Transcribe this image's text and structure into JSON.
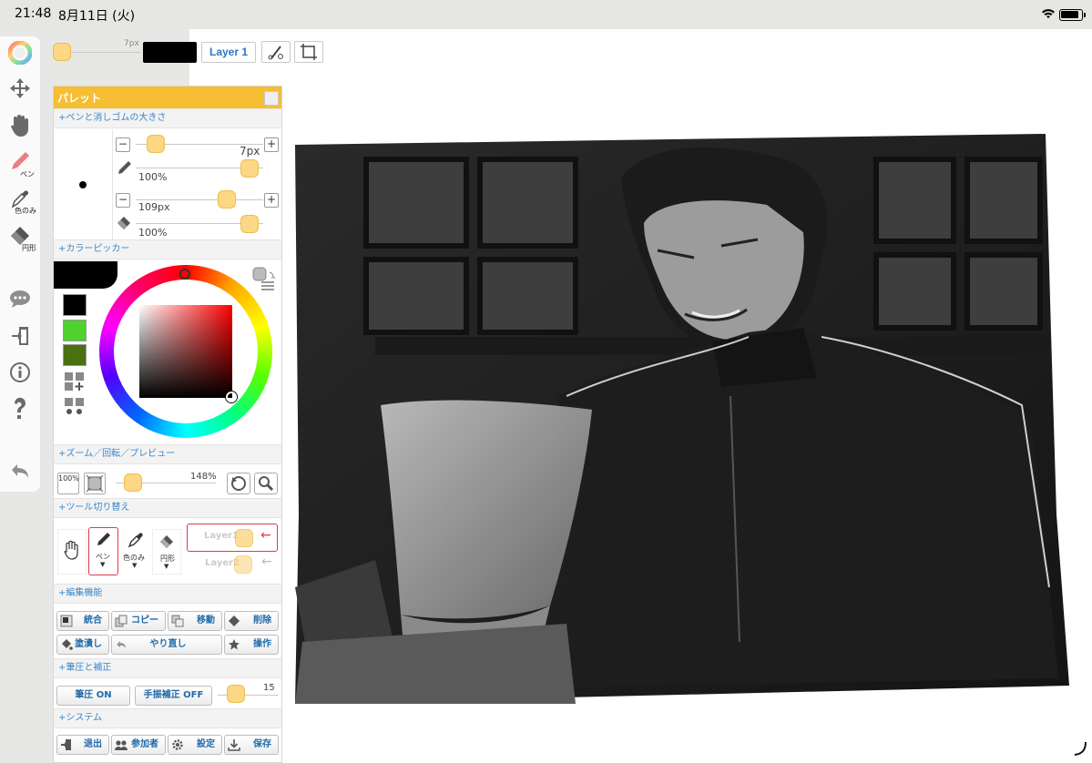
{
  "status": {
    "time": "21:48",
    "date": "8月11日 (火)"
  },
  "toolbar": {
    "items": [
      {
        "name": "color-wheel-icon",
        "label": ""
      },
      {
        "name": "move-icon",
        "label": ""
      },
      {
        "name": "hand-icon",
        "label": ""
      },
      {
        "name": "pen-icon",
        "label": "ペン"
      },
      {
        "name": "eyedropper-icon",
        "label": "色のみ"
      },
      {
        "name": "eraser-icon",
        "label": "円形"
      },
      {
        "name": "chat-icon",
        "label": ""
      },
      {
        "name": "exit-icon",
        "label": ""
      },
      {
        "name": "info-icon",
        "label": ""
      },
      {
        "name": "help-icon",
        "label": ""
      },
      {
        "name": "undo-icon",
        "label": ""
      }
    ]
  },
  "topbar": {
    "size_label": "7px",
    "layer_label": "Layer 1"
  },
  "palette": {
    "title": "パレット",
    "sections": {
      "brush": "+ペンと消しゴムの大きさ",
      "color": "+カラーピッカー",
      "zoom": "+ズーム／回転／プレビュー",
      "tools": "+ツール切り替え",
      "edit": "+編集機能",
      "pressure": "+筆圧と補正",
      "system": "+システム"
    },
    "pen": {
      "size": "7px",
      "opacity": "100%"
    },
    "eraser": {
      "size": "109px",
      "opacity": "100%"
    },
    "swatches": [
      "#000000",
      "#4fd12e",
      "#4a7010"
    ],
    "zoom": {
      "reset": "100%",
      "level": "148%"
    },
    "tool_labels": {
      "pen": "ペン",
      "dropper": "色のみ",
      "eraser": "円形"
    },
    "layers": [
      "Layer1",
      "Layer2"
    ],
    "edit_buttons": [
      "統合",
      "コピー",
      "移動",
      "削除",
      "塗潰し",
      "やり直し",
      "操作"
    ],
    "pressure_btn": "筆圧 ON",
    "stabilizer_btn": "手振補正 OFF",
    "stabilizer_value": "15",
    "system_buttons": [
      "退出",
      "参加者",
      "設定",
      "保存"
    ]
  },
  "colors": {
    "accent": "#f6be32",
    "link": "#2878c2",
    "knob": "#fcd784",
    "alert": "#e0394e"
  }
}
